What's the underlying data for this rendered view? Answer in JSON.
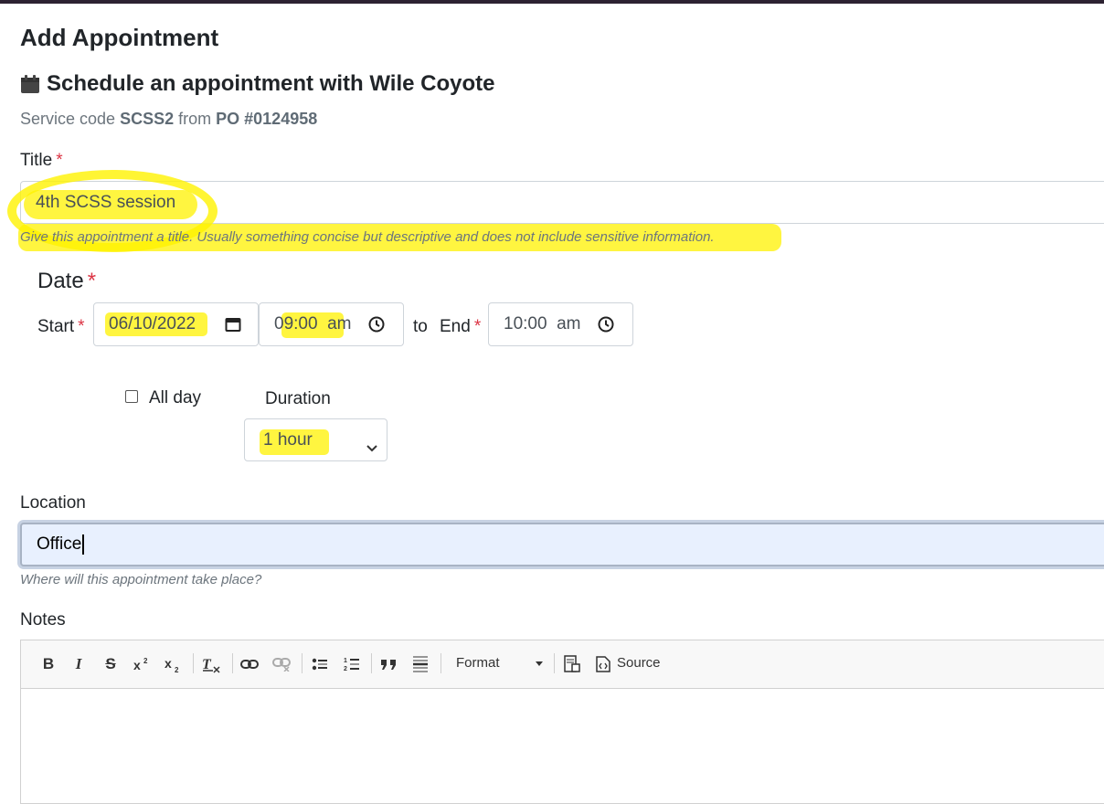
{
  "page": {
    "title": "Add Appointment",
    "subheading": "Schedule an appointment with Wile Coyote",
    "service_prefix": "Service code",
    "service_code": "SCSS2",
    "service_from": "from",
    "po_number": "PO #0124958"
  },
  "title_field": {
    "label": "Title",
    "required_mark": "*",
    "value": "4th SCSS session",
    "help": "Give this appointment a title. Usually something concise but descriptive and does not include sensitive information."
  },
  "date_section": {
    "heading": "Date",
    "required_mark": "*",
    "start_label": "Start",
    "start_date": "06/10/2022",
    "start_time": "09:00  am",
    "to_label": "to",
    "end_label": "End",
    "end_time": "10:00  am",
    "all_day_label": "All day",
    "all_day_checked": false,
    "duration_label": "Duration",
    "duration_value": "1 hour"
  },
  "location_field": {
    "label": "Location",
    "value": "Office",
    "help": "Where will this appointment take place?"
  },
  "notes_field": {
    "label": "Notes",
    "toolbar": {
      "format_label": "Format",
      "source_label": "Source",
      "bold": "B",
      "italic": "I",
      "strike": "S"
    }
  },
  "colors": {
    "highlight": "#fff200",
    "required": "#dc3545",
    "focused_input_bg": "#e8f0fe",
    "topbar": "#2d2232"
  },
  "icons": [
    "calendar-icon",
    "date-picker-icon",
    "clock-icon",
    "chevron-down-icon",
    "bold-icon",
    "italic-icon",
    "strike-icon",
    "superscript-icon",
    "subscript-icon",
    "remove-format-icon",
    "link-icon",
    "unlink-icon",
    "bulleted-list-icon",
    "numbered-list-icon",
    "blockquote-icon",
    "horizontal-rule-icon",
    "preview-icon",
    "source-icon"
  ]
}
